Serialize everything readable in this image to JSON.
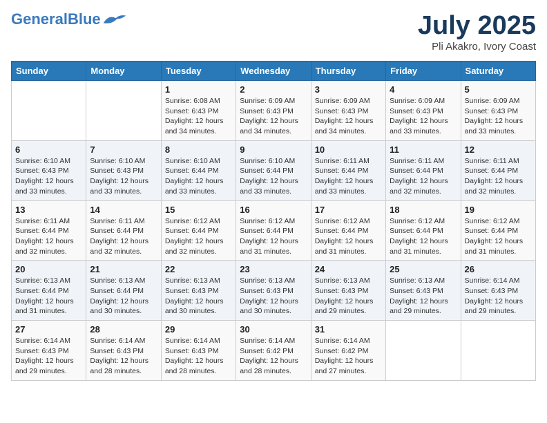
{
  "header": {
    "logo_general": "General",
    "logo_blue": "Blue",
    "month_title": "July 2025",
    "location": "Pli Akakro, Ivory Coast"
  },
  "weekdays": [
    "Sunday",
    "Monday",
    "Tuesday",
    "Wednesday",
    "Thursday",
    "Friday",
    "Saturday"
  ],
  "weeks": [
    [
      {
        "day": "",
        "detail": ""
      },
      {
        "day": "",
        "detail": ""
      },
      {
        "day": "1",
        "detail": "Sunrise: 6:08 AM\nSunset: 6:43 PM\nDaylight: 12 hours and 34 minutes."
      },
      {
        "day": "2",
        "detail": "Sunrise: 6:09 AM\nSunset: 6:43 PM\nDaylight: 12 hours and 34 minutes."
      },
      {
        "day": "3",
        "detail": "Sunrise: 6:09 AM\nSunset: 6:43 PM\nDaylight: 12 hours and 34 minutes."
      },
      {
        "day": "4",
        "detail": "Sunrise: 6:09 AM\nSunset: 6:43 PM\nDaylight: 12 hours and 33 minutes."
      },
      {
        "day": "5",
        "detail": "Sunrise: 6:09 AM\nSunset: 6:43 PM\nDaylight: 12 hours and 33 minutes."
      }
    ],
    [
      {
        "day": "6",
        "detail": "Sunrise: 6:10 AM\nSunset: 6:43 PM\nDaylight: 12 hours and 33 minutes."
      },
      {
        "day": "7",
        "detail": "Sunrise: 6:10 AM\nSunset: 6:43 PM\nDaylight: 12 hours and 33 minutes."
      },
      {
        "day": "8",
        "detail": "Sunrise: 6:10 AM\nSunset: 6:44 PM\nDaylight: 12 hours and 33 minutes."
      },
      {
        "day": "9",
        "detail": "Sunrise: 6:10 AM\nSunset: 6:44 PM\nDaylight: 12 hours and 33 minutes."
      },
      {
        "day": "10",
        "detail": "Sunrise: 6:11 AM\nSunset: 6:44 PM\nDaylight: 12 hours and 33 minutes."
      },
      {
        "day": "11",
        "detail": "Sunrise: 6:11 AM\nSunset: 6:44 PM\nDaylight: 12 hours and 32 minutes."
      },
      {
        "day": "12",
        "detail": "Sunrise: 6:11 AM\nSunset: 6:44 PM\nDaylight: 12 hours and 32 minutes."
      }
    ],
    [
      {
        "day": "13",
        "detail": "Sunrise: 6:11 AM\nSunset: 6:44 PM\nDaylight: 12 hours and 32 minutes."
      },
      {
        "day": "14",
        "detail": "Sunrise: 6:11 AM\nSunset: 6:44 PM\nDaylight: 12 hours and 32 minutes."
      },
      {
        "day": "15",
        "detail": "Sunrise: 6:12 AM\nSunset: 6:44 PM\nDaylight: 12 hours and 32 minutes."
      },
      {
        "day": "16",
        "detail": "Sunrise: 6:12 AM\nSunset: 6:44 PM\nDaylight: 12 hours and 31 minutes."
      },
      {
        "day": "17",
        "detail": "Sunrise: 6:12 AM\nSunset: 6:44 PM\nDaylight: 12 hours and 31 minutes."
      },
      {
        "day": "18",
        "detail": "Sunrise: 6:12 AM\nSunset: 6:44 PM\nDaylight: 12 hours and 31 minutes."
      },
      {
        "day": "19",
        "detail": "Sunrise: 6:12 AM\nSunset: 6:44 PM\nDaylight: 12 hours and 31 minutes."
      }
    ],
    [
      {
        "day": "20",
        "detail": "Sunrise: 6:13 AM\nSunset: 6:44 PM\nDaylight: 12 hours and 31 minutes."
      },
      {
        "day": "21",
        "detail": "Sunrise: 6:13 AM\nSunset: 6:44 PM\nDaylight: 12 hours and 30 minutes."
      },
      {
        "day": "22",
        "detail": "Sunrise: 6:13 AM\nSunset: 6:43 PM\nDaylight: 12 hours and 30 minutes."
      },
      {
        "day": "23",
        "detail": "Sunrise: 6:13 AM\nSunset: 6:43 PM\nDaylight: 12 hours and 30 minutes."
      },
      {
        "day": "24",
        "detail": "Sunrise: 6:13 AM\nSunset: 6:43 PM\nDaylight: 12 hours and 29 minutes."
      },
      {
        "day": "25",
        "detail": "Sunrise: 6:13 AM\nSunset: 6:43 PM\nDaylight: 12 hours and 29 minutes."
      },
      {
        "day": "26",
        "detail": "Sunrise: 6:14 AM\nSunset: 6:43 PM\nDaylight: 12 hours and 29 minutes."
      }
    ],
    [
      {
        "day": "27",
        "detail": "Sunrise: 6:14 AM\nSunset: 6:43 PM\nDaylight: 12 hours and 29 minutes."
      },
      {
        "day": "28",
        "detail": "Sunrise: 6:14 AM\nSunset: 6:43 PM\nDaylight: 12 hours and 28 minutes."
      },
      {
        "day": "29",
        "detail": "Sunrise: 6:14 AM\nSunset: 6:43 PM\nDaylight: 12 hours and 28 minutes."
      },
      {
        "day": "30",
        "detail": "Sunrise: 6:14 AM\nSunset: 6:42 PM\nDaylight: 12 hours and 28 minutes."
      },
      {
        "day": "31",
        "detail": "Sunrise: 6:14 AM\nSunset: 6:42 PM\nDaylight: 12 hours and 27 minutes."
      },
      {
        "day": "",
        "detail": ""
      },
      {
        "day": "",
        "detail": ""
      }
    ]
  ]
}
